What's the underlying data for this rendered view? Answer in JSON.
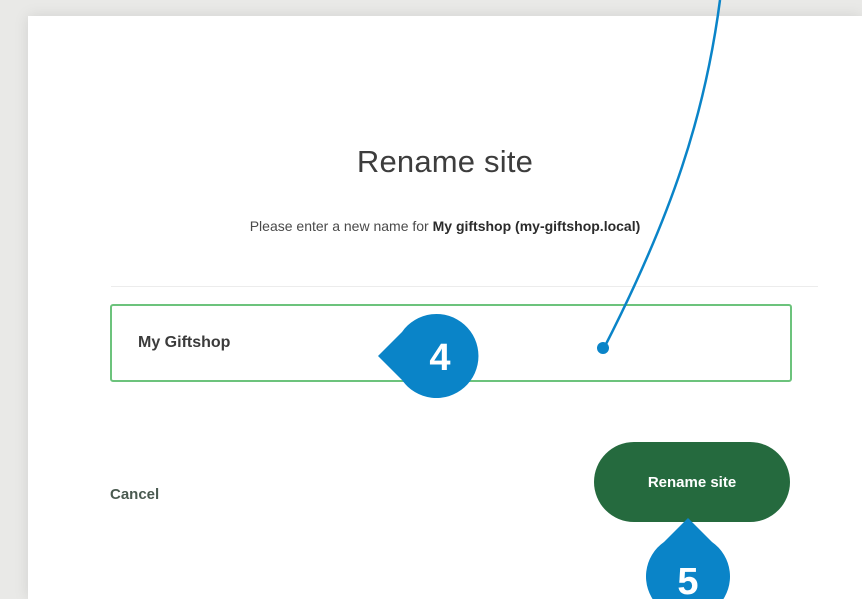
{
  "dialog": {
    "title": "Rename site",
    "subtitle": {
      "prefix": "Please enter a new name for ",
      "site_name": "My giftshop (my-giftshop.local)"
    },
    "name_input": {
      "value": "My Giftshop"
    },
    "cancel_label": "Cancel",
    "rename_label": "Rename site"
  },
  "callouts": [
    {
      "number": "4",
      "color": "#0a84c8"
    },
    {
      "number": "5",
      "color": "#0a84c8"
    }
  ],
  "colors": {
    "accent_green": "#256a3e",
    "input_border": "#6cc37c",
    "callout_blue": "#0a84c8"
  }
}
